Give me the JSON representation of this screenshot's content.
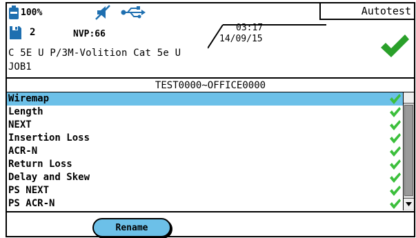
{
  "status": {
    "battery_text": "100%",
    "job_count": "2",
    "nvp_text": "NVP:66",
    "time": "03:17",
    "date": "14/09/15",
    "mode": "Autotest"
  },
  "cable": {
    "type_line": "C 5E U P/3M-Volition Cat 5e U",
    "job_line": "JOB1"
  },
  "test": {
    "header": "TEST0000~OFFICE0000",
    "items": [
      {
        "label": "Wiremap",
        "result": "pass"
      },
      {
        "label": "Length",
        "result": "pass"
      },
      {
        "label": "NEXT",
        "result": "pass"
      },
      {
        "label": "Insertion Loss",
        "result": "pass"
      },
      {
        "label": "ACR-N",
        "result": "pass"
      },
      {
        "label": "Return Loss",
        "result": "pass"
      },
      {
        "label": "Delay and Skew",
        "result": "pass"
      },
      {
        "label": "PS NEXT",
        "result": "pass"
      },
      {
        "label": "PS ACR-N",
        "result": "pass"
      }
    ]
  },
  "footer": {
    "rename_label": "Rename"
  },
  "colors": {
    "selection": "#6cc0e8",
    "pass_green": "#2aa02a"
  },
  "icons": [
    "battery-icon",
    "mute-speaker-icon",
    "usb-icon",
    "floppy-disk-icon",
    "pass-check-icon"
  ]
}
